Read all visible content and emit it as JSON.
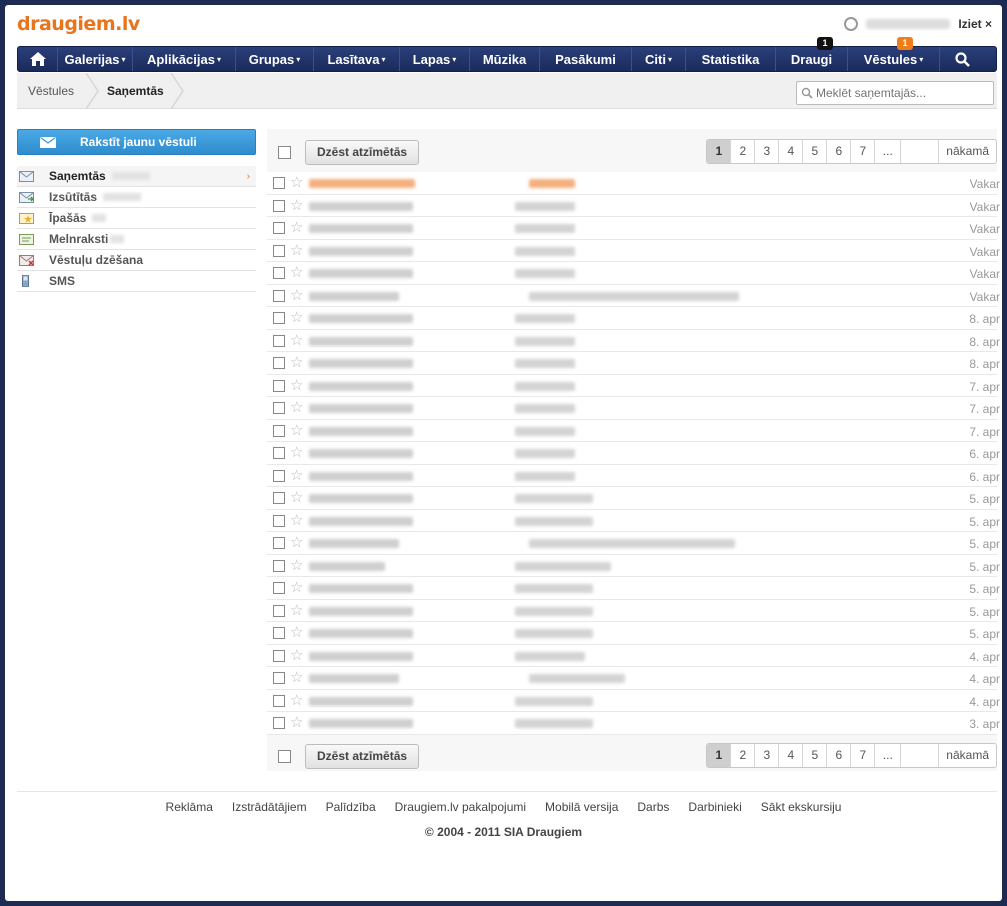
{
  "header": {
    "logo": "draugiem.lv",
    "logout_label": "Iziet ×"
  },
  "nav": {
    "items": [
      {
        "label": "Galerijas",
        "dropdown": true
      },
      {
        "label": "Aplikācijas",
        "dropdown": true
      },
      {
        "label": "Grupas",
        "dropdown": true
      },
      {
        "label": "Lasītava",
        "dropdown": true
      },
      {
        "label": "Lapas",
        "dropdown": true
      },
      {
        "label": "Mūzika",
        "dropdown": false
      },
      {
        "label": "Pasākumi",
        "dropdown": false
      },
      {
        "label": "Citi",
        "dropdown": true
      },
      {
        "label": "Statistika",
        "dropdown": false
      },
      {
        "label": "Draugi",
        "dropdown": false,
        "badge": "1",
        "badge_color": "#111111"
      },
      {
        "label": "Vēstules",
        "dropdown": true,
        "badge": "1",
        "badge_color": "#f07d1a"
      }
    ],
    "arrow": "▾"
  },
  "breadcrumb": {
    "items": [
      "Vēstules",
      "Saņemtās"
    ]
  },
  "search": {
    "placeholder": "Meklēt saņemtajās..."
  },
  "sidebar": {
    "compose_label": "Rakstīt jaunu vēstuli",
    "items": [
      {
        "label": "Saņemtās",
        "icon": "inbox-icon",
        "active": true
      },
      {
        "label": "Izsūtītās",
        "icon": "sent-icon",
        "active": false
      },
      {
        "label": "Īpašās",
        "icon": "special-icon",
        "active": false
      },
      {
        "label": "Melnraksti",
        "icon": "drafts-icon",
        "active": false
      },
      {
        "label": "Vēstuļu dzēšana",
        "icon": "delete-messages-icon",
        "active": false
      },
      {
        "label": "SMS",
        "icon": "phone-icon",
        "active": false
      }
    ]
  },
  "toolbar": {
    "delete_label": "Dzēst atzīmētās",
    "pages": [
      "1",
      "2",
      "3",
      "4",
      "5",
      "6",
      "7",
      "..."
    ],
    "next_label": "nākamā"
  },
  "messages": {
    "dates": [
      "Vakar",
      "Vakar",
      "Vakar",
      "Vakar",
      "Vakar",
      "Vakar",
      "8. apr",
      "8. apr",
      "8. apr",
      "7. apr",
      "7. apr",
      "7. apr",
      "6. apr",
      "6. apr",
      "5. apr",
      "5. apr",
      "5. apr",
      "5. apr",
      "5. apr",
      "5. apr",
      "5. apr",
      "4. apr",
      "4. apr",
      "4. apr",
      "3. apr"
    ]
  },
  "footer": {
    "links": [
      "Reklāma",
      "Izstrādātājiem",
      "Palīdzība",
      "Draugiem.lv pakalpojumi",
      "Mobilā versija",
      "Darbs",
      "Darbinieki",
      "Sākt ekskursiju"
    ],
    "copyright": "© 2004 - 2011 SIA Draugiem"
  },
  "colors": {
    "accent": "#e8741c",
    "nav_bg": "#1f3166",
    "compose_bg": "#3b9ad9"
  }
}
